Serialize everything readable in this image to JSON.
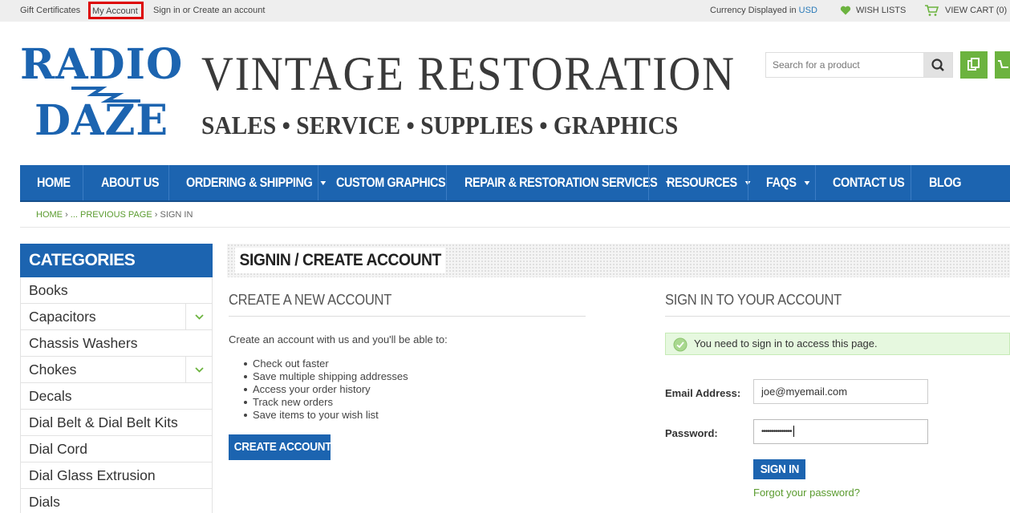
{
  "topbar": {
    "gift_certificates": "Gift Certificates",
    "my_account": "My Account",
    "signin_create": "Sign in or Create an account",
    "currency_prefix": "Currency Displayed in",
    "currency": "USD",
    "wish_lists": "WISH LISTS",
    "view_cart": "VIEW CART (0)"
  },
  "logo": {
    "line1": "RADIO",
    "line2": "DAZE"
  },
  "brand": {
    "title": "VINTAGE  RESTORATION",
    "subtitle": "SALES • SERVICE • SUPPLIES • GRAPHICS"
  },
  "search": {
    "placeholder": "Search for a product"
  },
  "nav": {
    "items": [
      {
        "label": "HOME"
      },
      {
        "label": "ABOUT US"
      },
      {
        "label": "ORDERING & SHIPPING"
      },
      {
        "label": "CUSTOM GRAPHICS"
      },
      {
        "label": "REPAIR & RESTORATION SERVICES"
      },
      {
        "label": "RESOURCES"
      },
      {
        "label": "FAQS"
      },
      {
        "label": "CONTACT US"
      },
      {
        "label": "BLOG"
      }
    ]
  },
  "breadcrumb": {
    "home": "HOME",
    "previous": "... PREVIOUS PAGE",
    "current": "SIGN IN"
  },
  "sidebar": {
    "title": "CATEGORIES",
    "items": [
      {
        "label": "Books"
      },
      {
        "label": "Capacitors"
      },
      {
        "label": "Chassis Washers"
      },
      {
        "label": "Chokes"
      },
      {
        "label": "Decals"
      },
      {
        "label": "Dial Belt & Dial Belt Kits"
      },
      {
        "label": "Dial Cord"
      },
      {
        "label": "Dial Glass Extrusion"
      },
      {
        "label": "Dials"
      }
    ]
  },
  "main": {
    "heading": "SIGNIN / CREATE ACCOUNT",
    "create": {
      "title": "CREATE A NEW ACCOUNT",
      "intro": "Create an account with us and you'll be able to:",
      "benefits": [
        "Check out faster",
        "Save multiple shipping addresses",
        "Access your order history",
        "Track new orders",
        "Save items to your wish list"
      ],
      "button": "CREATE ACCOUNT"
    },
    "signin": {
      "title": "SIGN IN TO YOUR ACCOUNT",
      "alert": "You need to sign in to access this page.",
      "email_label": "Email Address:",
      "email_value": "joe@myemail.com",
      "password_label": "Password:",
      "password_value": "•••••••••••••••",
      "button": "SIGN IN",
      "forgot": "Forgot your password?"
    }
  },
  "colors": {
    "brand_blue": "#1c64b0",
    "accent_green": "#6cb33f",
    "alert_bg": "#e6f8df",
    "highlight_red": "#dd0000"
  }
}
